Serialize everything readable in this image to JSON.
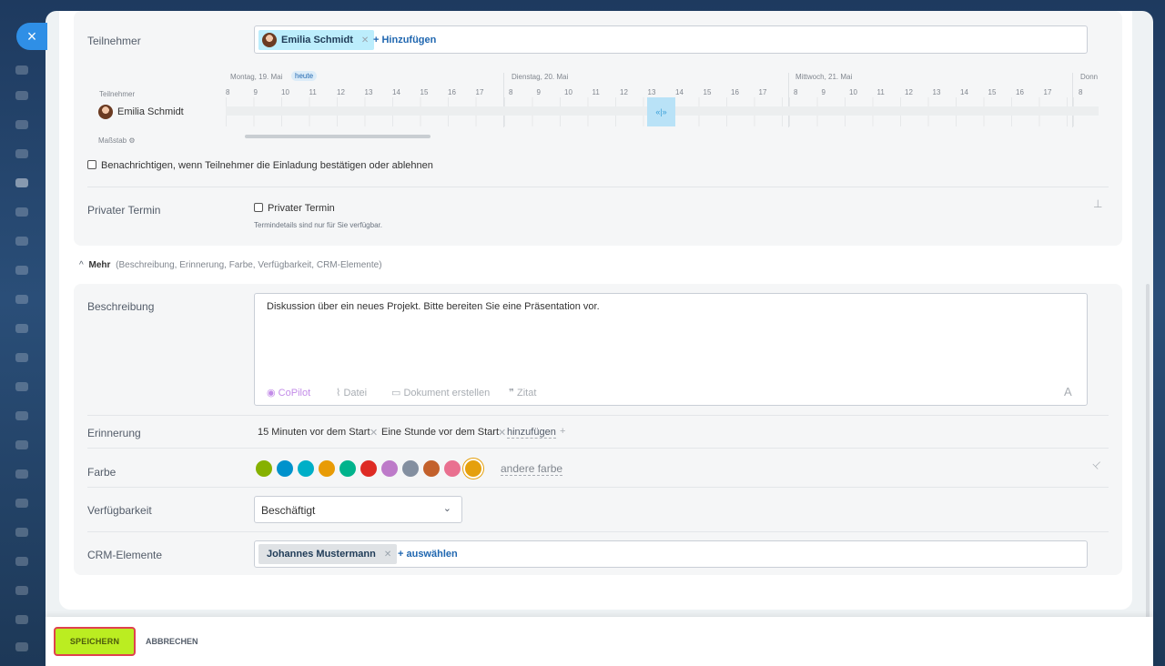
{
  "close_label": "×",
  "participants": {
    "label": "Teilnehmer",
    "chip_name": "Emilia Schmidt",
    "add_label": "+ Hinzufügen"
  },
  "timeline": {
    "days": [
      {
        "label": "Montag, 19. Mai",
        "today": "heute"
      },
      {
        "label": "Dienstag, 20. Mai"
      },
      {
        "label": "Mittwoch, 21. Mai"
      },
      {
        "label": "Donn"
      }
    ],
    "hours": [
      "8",
      "9",
      "10",
      "11",
      "12",
      "13",
      "14",
      "15",
      "16",
      "17"
    ],
    "row_header": "Teilnehmer",
    "participant": "Emilia Schmidt",
    "scale_label": "Maßstab",
    "selection_icon": "«|»"
  },
  "notify_label": "Benachrichtigen, wenn Teilnehmer die Einladung bestätigen oder ablehnen",
  "private": {
    "label": "Privater Termin",
    "checkbox_label": "Privater Termin",
    "hint": "Termindetails sind nur für Sie verfügbar."
  },
  "more": {
    "title": "Mehr",
    "subtitle": "(Beschreibung, Erinnerung, Farbe, Verfügbarkeit, CRM-Elemente)"
  },
  "description": {
    "label": "Beschreibung",
    "text": "Diskussion über ein neues Projekt. Bitte bereiten Sie eine Präsentation vor.",
    "tools": {
      "copilot": "CoPilot",
      "file": "Datei",
      "document": "Dokument erstellen",
      "quote": "Zitat",
      "format": "A"
    }
  },
  "reminder": {
    "label": "Erinnerung",
    "items": [
      "15 Minuten vor dem Start",
      "Eine Stunde vor dem Start"
    ],
    "add_label": "hinzufügen"
  },
  "color": {
    "label": "Farbe",
    "swatches": [
      "#86b100",
      "#0092cc",
      "#00afc7",
      "#e89b06",
      "#00b38c",
      "#de2b24",
      "#bd7ac9",
      "#838fa0",
      "#c3612c",
      "#e97090",
      "#e5a00d"
    ],
    "selected_index": 10,
    "other_label": "andere farbe"
  },
  "availability": {
    "label": "Verfügbarkeit",
    "value": "Beschäftigt"
  },
  "crm": {
    "label": "CRM-Elemente",
    "chip": "Johannes Mustermann",
    "add_label": "+ auswählen"
  },
  "footer": {
    "save": "SPEICHERN",
    "cancel": "ABBRECHEN"
  }
}
